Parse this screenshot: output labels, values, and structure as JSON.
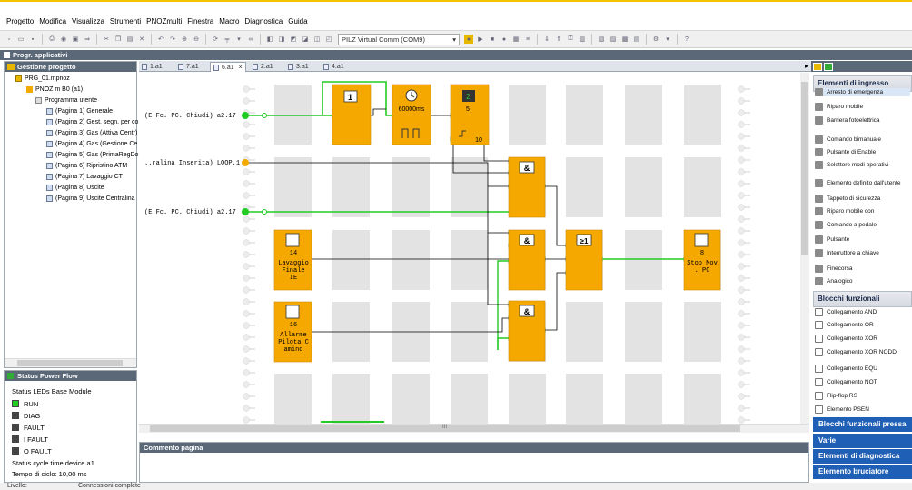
{
  "menu": [
    "Progetto",
    "Modifica",
    "Visualizza",
    "Strumenti",
    "PNOZmulti",
    "Finestra",
    "Macro",
    "Diagnostica",
    "Guida"
  ],
  "toolbar": {
    "connection": "PILZ Virtual Comm (COM9)"
  },
  "progtab": {
    "label": "Progr. applicativi"
  },
  "project_panel": {
    "title": "Gestione progetto",
    "project": "PRG_01.mpnoz",
    "device": "PNOZ m B0 (a1)",
    "program": "Programma utente",
    "pages": [
      "(Pagina 1) Generale",
      "(Pagina 2) Gest. segn. per co",
      "(Pagina 3) Gas (Attiva Centr)",
      "(Pagina 4) Gas (Gestione Ce",
      "(Pagina 5) Gas (PrimaRegDo",
      "(Pagina 6) Ripristino ATM",
      "(Pagina 7) Lavaggio CT",
      "(Pagina 8) Uscite",
      "(Pagina 9) Uscite Centralina"
    ]
  },
  "status_panel": {
    "title": "Status Power Flow",
    "leds_title": "Status LEDs Base Module",
    "leds": [
      {
        "label": "RUN",
        "color": "#22cc22"
      },
      {
        "label": "DIAG",
        "color": "#444444"
      },
      {
        "label": "FAULT",
        "color": "#444444"
      },
      {
        "label": "I FAULT",
        "color": "#444444"
      },
      {
        "label": "O FAULT",
        "color": "#444444"
      }
    ],
    "cycle_device": "Status cycle time device  a1",
    "cycle_time": "Tempo di ciclo: 10,00 ms"
  },
  "editor_tabs": [
    "1.a1",
    "7.a1",
    "6.a1",
    "2.a1",
    "3.a1",
    "4.a1"
  ],
  "editor_close": "×",
  "diagram": {
    "inputs": [
      "(E Fc. PC. Chiudi) a2.17",
      "..ralina Inserita) LOOP.1",
      "(E Fc. PC. Chiudi) a2.17"
    ],
    "blocks": {
      "flipflop_label": "1",
      "timer_value": "60000ms",
      "counter_top": "5",
      "counter_bottom": "10",
      "and_label": "&",
      "or_label": "≥1",
      "out1_num": "14",
      "out1_text": "Lavaggio\nFinale\nIE",
      "out2_num": "16",
      "out2_text": "Allarme\nPilota C\namino",
      "out3_num": "8",
      "out3_text": "Stop Mov\n. PC"
    },
    "colors": {
      "block": "#f5a800",
      "active": "#22cc22",
      "inactive": "#f2a900",
      "wire": "#000000"
    }
  },
  "hscroll_label": "III",
  "comment": {
    "title": "Commento pagina"
  },
  "right_panel": {
    "input_header": "Elementi di ingresso",
    "input_items": [
      "Arresto di emergenza",
      "Riparo mobile",
      "Barriera fotoelettrica",
      "Comando bimanuale",
      "Pulsante di Enable",
      "Selettore modi operativi",
      "Elemento definito dall'utente",
      "Tappeto di sicurezza",
      "Riparo mobile con",
      "Comando a pedale",
      "Pulsante",
      "Interruttore a chiave",
      "Finecorsa",
      "Analogico"
    ],
    "fb_header": "Blocchi funzionali",
    "fb_items": [
      "Collegamento AND",
      "Collegamento OR",
      "Collegamento XOR",
      "Collegamento XOR NODD",
      "Collegamento EQU",
      "Collegamento NOT",
      "Flip-flop RS",
      "Elemento PSEN"
    ],
    "bars": [
      "Blocchi funzionali pressa",
      "Varie",
      "Elementi di diagnostica",
      "Elemento bruciatore"
    ]
  },
  "statusbar": {
    "level": "Livello:",
    "connection": "Connessioni complete"
  }
}
